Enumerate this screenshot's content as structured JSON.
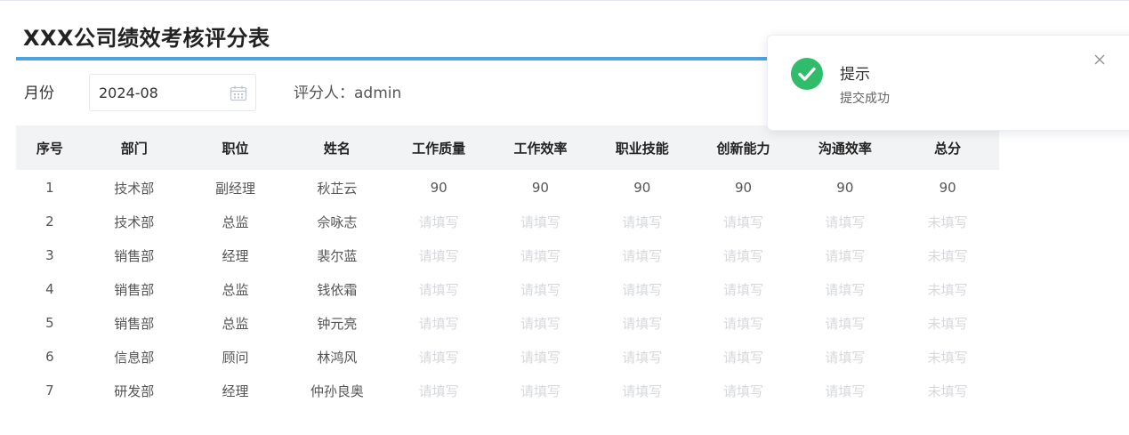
{
  "header": {
    "title": "XXX公司绩效考核评分表"
  },
  "filters": {
    "month_label": "月份",
    "month_value": "2024-08",
    "rater_label": "评分人：",
    "rater_name": "admin"
  },
  "table": {
    "columns": [
      "序号",
      "部门",
      "职位",
      "姓名",
      "工作质量",
      "工作效率",
      "职业技能",
      "创新能力",
      "沟通效率",
      "总分"
    ],
    "rows": [
      [
        "1",
        "技术部",
        "副经理",
        "秋芷云",
        "90",
        "90",
        "90",
        "90",
        "90",
        "90"
      ],
      [
        "2",
        "技术部",
        "总监",
        "佘咏志",
        "请填写",
        "请填写",
        "请填写",
        "请填写",
        "请填写",
        "未填写"
      ],
      [
        "3",
        "销售部",
        "经理",
        "裴尔蓝",
        "请填写",
        "请填写",
        "请填写",
        "请填写",
        "请填写",
        "未填写"
      ],
      [
        "4",
        "销售部",
        "总监",
        "钱依霜",
        "请填写",
        "请填写",
        "请填写",
        "请填写",
        "请填写",
        "未填写"
      ],
      [
        "5",
        "销售部",
        "总监",
        "钟元亮",
        "请填写",
        "请填写",
        "请填写",
        "请填写",
        "请填写",
        "未填写"
      ],
      [
        "6",
        "信息部",
        "顾问",
        "林鸿风",
        "请填写",
        "请填写",
        "请填写",
        "请填写",
        "请填写",
        "未填写"
      ],
      [
        "7",
        "研发部",
        "经理",
        "仲孙良奥",
        "请填写",
        "请填写",
        "请填写",
        "请填写",
        "请填写",
        "未填写"
      ]
    ]
  },
  "notification": {
    "title": "提示",
    "message": "提交成功",
    "icon": "check-circle-icon",
    "close_icon": "close-icon"
  },
  "colors": {
    "accent": "#4fa3e0",
    "success": "#2fbd6b",
    "header_bg": "#f2f3f5",
    "placeholder_text": "#d6d8dc"
  }
}
